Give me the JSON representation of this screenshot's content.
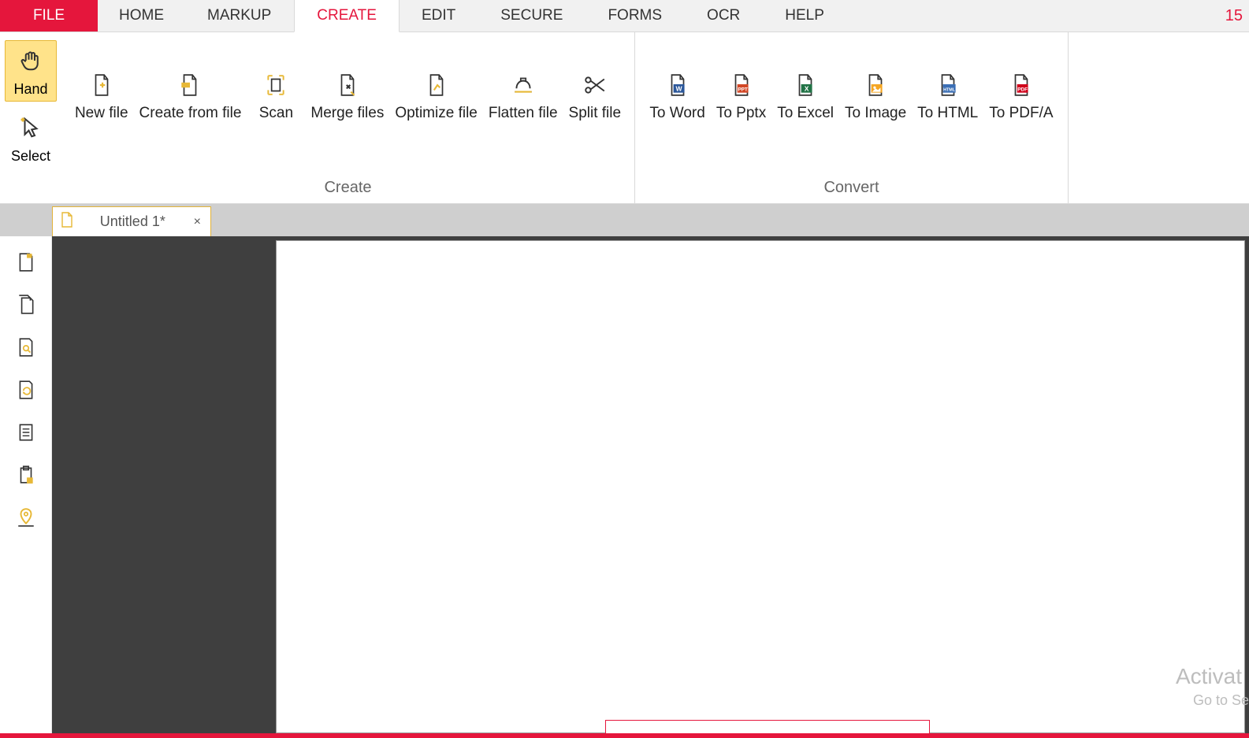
{
  "menubar": {
    "tabs": [
      "FILE",
      "HOME",
      "MARKUP",
      "CREATE",
      "EDIT",
      "SECURE",
      "FORMS",
      "OCR",
      "HELP"
    ],
    "active_index": 3,
    "right_number": "15"
  },
  "left_tools": {
    "hand": "Hand",
    "select": "Select",
    "active": "hand"
  },
  "ribbon": {
    "groups": [
      {
        "name": "Create",
        "items": [
          {
            "label": "New file",
            "icon": "new-file-icon"
          },
          {
            "label": "Create from file",
            "icon": "create-from-file-icon"
          },
          {
            "label": "Scan",
            "icon": "scan-icon"
          },
          {
            "label": "Merge files",
            "icon": "merge-files-icon"
          },
          {
            "label": "Optimize file",
            "icon": "optimize-file-icon"
          },
          {
            "label": "Flatten file",
            "icon": "flatten-file-icon"
          },
          {
            "label": "Split file",
            "icon": "split-file-icon"
          }
        ]
      },
      {
        "name": "Convert",
        "items": [
          {
            "label": "To Word",
            "icon": "to-word-icon",
            "badge": "W",
            "badge_color": "#2b579a"
          },
          {
            "label": "To Pptx",
            "icon": "to-pptx-icon",
            "badge": "PPT",
            "badge_color": "#d24726"
          },
          {
            "label": "To Excel",
            "icon": "to-excel-icon",
            "badge": "X",
            "badge_color": "#217346"
          },
          {
            "label": "To Image",
            "icon": "to-image-icon",
            "badge": "",
            "badge_color": "#f5a623"
          },
          {
            "label": "To HTML",
            "icon": "to-html-icon",
            "badge": "HTML",
            "badge_color": "#3b6fb5"
          },
          {
            "label": "To PDF/A",
            "icon": "to-pdfa-icon",
            "badge": "PDF",
            "badge_color": "#d0021b"
          }
        ]
      }
    ]
  },
  "doctabs": {
    "tabs": [
      {
        "title": "Untitled 1*",
        "close": "×"
      }
    ]
  },
  "side_panel_buttons": [
    "thumbnails-icon",
    "pages-icon",
    "search-page-icon",
    "rotate-icon",
    "outline-icon",
    "clipboard-icon",
    "geo-pin-icon"
  ],
  "watermark": {
    "line1": "Activat",
    "line2": "Go to Se"
  },
  "tooltip_fragment": ""
}
